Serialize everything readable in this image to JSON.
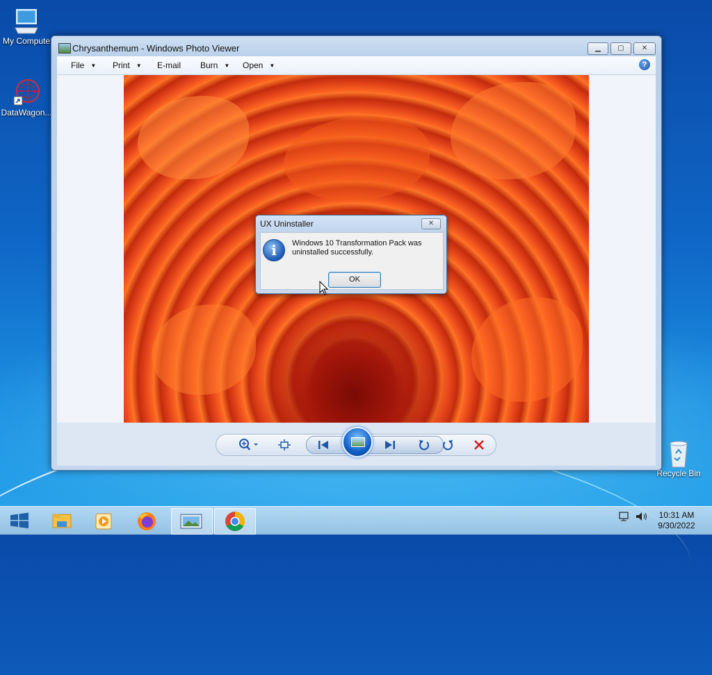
{
  "desktop": {
    "icons": [
      {
        "label": "My Compute"
      },
      {
        "label": "DataWagon..."
      },
      {
        "label": "Recycle Bin"
      }
    ]
  },
  "window": {
    "title": "Chrysanthemum - Windows Photo Viewer",
    "menu": [
      "File",
      "Print",
      "E-mail",
      "Burn",
      "Open"
    ],
    "help_glyph": "?"
  },
  "dialog": {
    "title": "UX Uninstaller",
    "message": "Windows 10 Transformation Pack was uninstalled successfully.",
    "ok_label": "OK",
    "close_glyph": "✕"
  },
  "controls": {
    "icons": [
      "zoom-icon",
      "actual-size-icon",
      "previous-icon",
      "slideshow-icon",
      "next-icon",
      "rotate-ccw-icon",
      "rotate-cw-icon",
      "delete-icon"
    ]
  },
  "taskbar": {
    "apps": [
      "start",
      "file-explorer",
      "media-player",
      "firefox",
      "photo-viewer",
      "chrome"
    ],
    "time": "10:31 AM",
    "date": "9/30/2022"
  },
  "colors": {
    "desktop_blue": "#0f66c6",
    "delete_red": "#d01c1c",
    "accent": "#1e57a8"
  }
}
